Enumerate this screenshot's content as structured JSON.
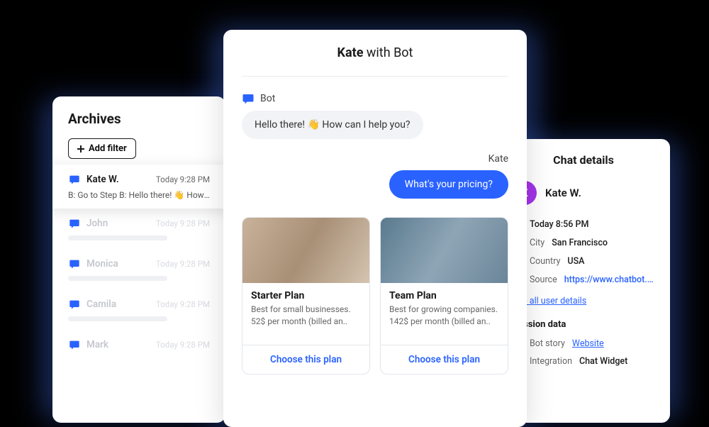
{
  "archives": {
    "title": "Archives",
    "add_filter": "Add filter",
    "items": [
      {
        "name": "Kate W.",
        "time": "Today 9:28 PM",
        "preview": "B: Go to Step B: Hello there! 👋 How can I..",
        "active": true
      },
      {
        "name": "John",
        "time": "Today 9:28 PM"
      },
      {
        "name": "Monica",
        "time": "Today 9:28 PM"
      },
      {
        "name": "Camila",
        "time": "Today 9:28 PM"
      },
      {
        "name": "Mark",
        "time": "Today 9:28 PM"
      }
    ]
  },
  "chat": {
    "title_name": "Kate",
    "title_suffix": "with Bot",
    "bot_label": "Bot",
    "bot_message": "Hello there! 👋 How can I help you?",
    "user_label": "Kate",
    "user_message": "What's your pricing?",
    "plans": [
      {
        "title": "Starter Plan",
        "desc": "Best for small businesses. 52$ per month (billed an..",
        "cta": "Choose this plan"
      },
      {
        "title": "Team Plan",
        "desc": "Best for growing companies. 142$ per month (billed an..",
        "cta": "Choose this plan"
      }
    ]
  },
  "details": {
    "title": "Chat details",
    "avatar_initial": "K",
    "user_name": "Kate W.",
    "meta": {
      "time": "Today 8:56 PM",
      "city_label": "City",
      "city": "San Francisco",
      "country_label": "Country",
      "country": "USA",
      "source_label": "Source",
      "source": "https://www.chatbot.com/..."
    },
    "see_all": "See all user details",
    "session_title": "Session data",
    "session": {
      "bot_story_label": "Bot story",
      "bot_story": "Website",
      "integration_label": "Integration",
      "integration": "Chat Widget"
    }
  }
}
